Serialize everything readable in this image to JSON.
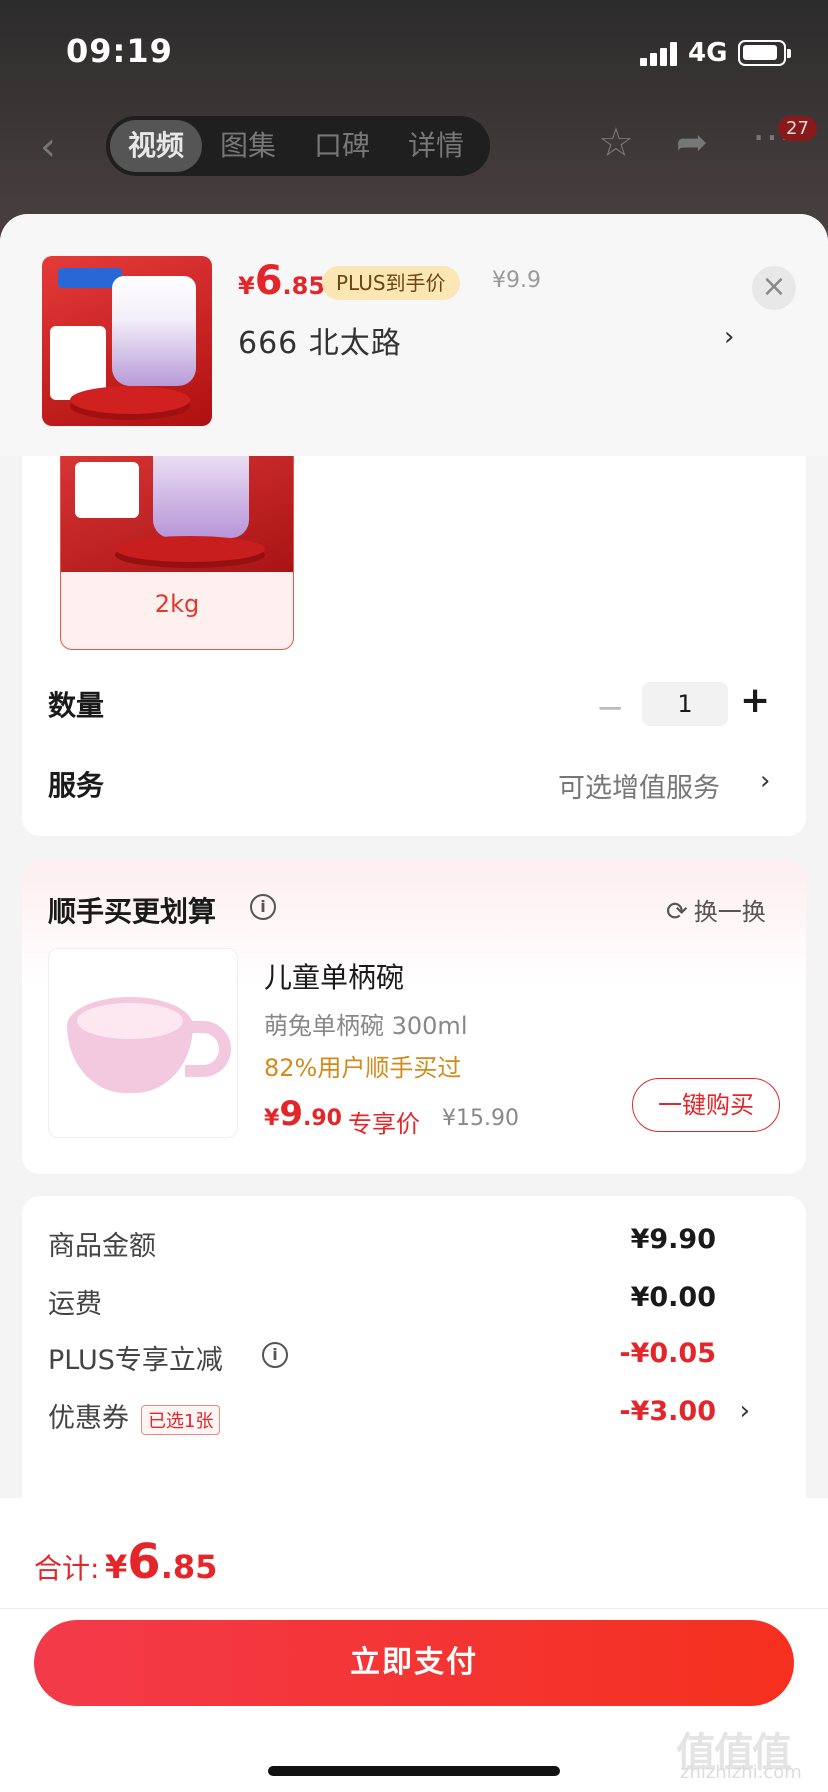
{
  "status_bar": {
    "time": "09:19",
    "network": "4G"
  },
  "nav": {
    "tabs": [
      {
        "label": "视频",
        "active": true
      },
      {
        "label": "图集",
        "active": false
      },
      {
        "label": "口碑",
        "active": false
      },
      {
        "label": "详情",
        "active": false
      }
    ],
    "more_badge": "27",
    "icons": [
      "back-arrow-icon",
      "star-icon",
      "share-icon",
      "more-icon"
    ]
  },
  "product_header": {
    "price_symbol": "¥",
    "price_int": "6",
    "price_dec": ".85",
    "plus_tag": "PLUS到手价",
    "original_price": "¥9.9",
    "address": "666  北太路"
  },
  "spec": {
    "selected_label": "2kg"
  },
  "quantity": {
    "label": "数量",
    "value": "1"
  },
  "service": {
    "label": "服务",
    "value": "可选增值服务"
  },
  "upsell": {
    "title": "顺手买更划算",
    "refresh_label": "换一换",
    "item": {
      "name": "儿童单柄碗",
      "desc": "萌兔单柄碗 300ml",
      "buy_rate": "82%用户顺手买过",
      "price_symbol": "¥",
      "price_int": "9",
      "price_dec": ".90",
      "exclusive_label": "专享价",
      "original_price": "¥15.90",
      "buy_button": "一键购买"
    }
  },
  "summary": {
    "rows": [
      {
        "label": "商品金额",
        "value": "¥9.90"
      },
      {
        "label": "运费",
        "value": "¥0.00"
      },
      {
        "label": "PLUS专享立减",
        "value": "-¥0.05"
      },
      {
        "label": "优惠券",
        "tag": "已选1张",
        "value": "-¥3.00"
      }
    ]
  },
  "footer": {
    "total_label": "合计:",
    "total_symbol": "¥",
    "total_int": "6",
    "total_dec": ".85",
    "pay_button": "立即支付"
  },
  "colors": {
    "accent_red": "#e4262a",
    "plus_gold": "#fbe6b4"
  }
}
